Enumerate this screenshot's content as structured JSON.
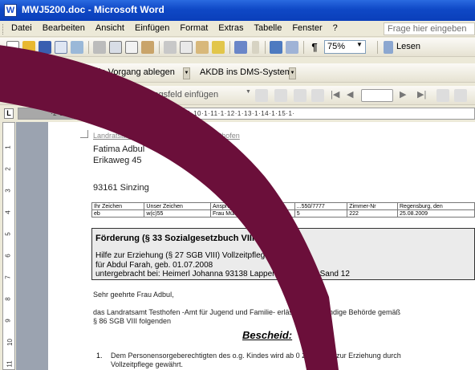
{
  "window": {
    "title": "MWJ5200.doc - Microsoft Word",
    "app_icon_glyph": "W"
  },
  "menubar": {
    "items": [
      "Datei",
      "Bearbeiten",
      "Ansicht",
      "Einfügen",
      "Format",
      "Extras",
      "Tabelle",
      "Fenster",
      "?"
    ],
    "help_placeholder": "Frage hier eingeben"
  },
  "toolbar_standard": {
    "zoom": "75%",
    "read_label": "Lesen"
  },
  "toolbar_custom": {
    "file_in_process": "in Vorgang ablegen",
    "akdb_dms": "AKDB ins DMS-System"
  },
  "toolbar_mailmerge": {
    "insert_condition_field": "Bedingungsfeld einfügen"
  },
  "ruler": {
    "corner": "L",
    "marks": "·2·1·1·1·X·1·1·2·1·3· · ·5·1·6·1·7·1·8·1·9·1·10·1·11·1·12·1·13·1·14·1·15·1·"
  },
  "vruler_marks": [
    "1",
    "2",
    "3",
    "4",
    "5",
    "6",
    "7",
    "8",
    "9",
    "10",
    "11"
  ],
  "document": {
    "sender_line": "Landratsamt Testhofen Postfach  90  Testhofen",
    "recipient": [
      "Fatima Adbul",
      "Erikaweg 45",
      "",
      "93161 Sinzing"
    ],
    "info_table": {
      "headers": [
        "Ihr Zeichen",
        "Unser Zeichen",
        "Ansprechpartner/in",
        "...550/7777",
        "Zimmer-Nr",
        "Regensburg, den"
      ],
      "values": [
        "eb",
        "w(c)55",
        "Frau Müller",
        "5",
        "222",
        "25.08.2009"
      ]
    },
    "box": {
      "title": "Förderung (§ 33 Sozialgesetzbuch VIII - SGB VIII);",
      "lines": [
        "Hilfe zur Erziehung (§ 27 SGB VIII)  Vollzeitpflege",
        "für Abdul Farah, geb. 01.07.2008",
        "untergebracht bei: Heimerl Johanna  93138 Lappersdorf  Am ho     Sand 12"
      ]
    },
    "salutation": "Sehr geehrte Frau Adbul,",
    "intro_lines": [
      "das Landratsamt Testhofen -Amt für Jugend und Familie- erlässt als         zuständige Behörde gemäß",
      "§ 86 SGB VIII folgenden"
    ],
    "heading": "Bescheid:",
    "item1_number": "1.",
    "item1_lines": [
      "Dem Personensorgeberechtigten des o.g. Kindes wird ab  0       2009  Hilfe zur Erziehung durch",
      "Vollzeitpflege gewährt."
    ]
  },
  "colors": {
    "title_bar": "#0f48c6",
    "stroke": "#6b0f3a",
    "document_bg": "#9ba3b0"
  }
}
